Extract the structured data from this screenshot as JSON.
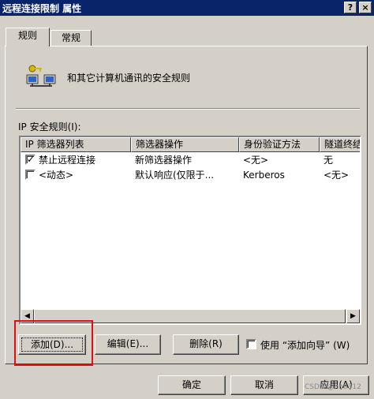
{
  "window": {
    "title": "远程连接限制 属性",
    "help_glyph": "?",
    "close_glyph": "×"
  },
  "tabs": [
    {
      "label": "规则",
      "selected": true
    },
    {
      "label": "常规",
      "selected": false
    }
  ],
  "header": {
    "description": "和其它计算机通讯的安全规则",
    "icon": "network-computers-icon"
  },
  "rules_list": {
    "label": "IP 安全规则(I):",
    "columns": [
      "IP 筛选器列表",
      "筛选器操作",
      "身份验证方法",
      "隧道终结"
    ],
    "rows": [
      {
        "checked": true,
        "filter_list": "禁止远程连接",
        "filter_action": "新筛选器操作",
        "auth": "<无>",
        "tunnel": "无"
      },
      {
        "checked": false,
        "filter_list": "<动态>",
        "filter_action": "默认响应(仅限于...",
        "auth": "Kerberos",
        "tunnel": "<无>"
      }
    ],
    "scroll_left": "◀",
    "scroll_right": "▶"
  },
  "actions": {
    "add": "添加(D)...",
    "edit": "编辑(E)...",
    "remove": "删除(R)",
    "use_wizard_label": "使用 “添加向导” (W)",
    "use_wizard_checked": false
  },
  "footer": {
    "ok": "确定",
    "cancel": "取消",
    "apply": "应用(A)"
  },
  "watermark": "CSDN @hh0312"
}
